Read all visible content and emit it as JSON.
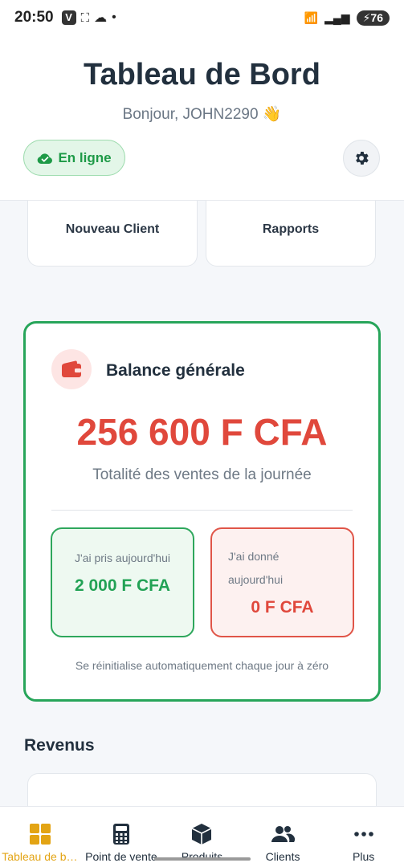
{
  "status_bar": {
    "time": "20:50",
    "battery": "76"
  },
  "header": {
    "title": "Tableau de Bord",
    "greeting": "Bonjour, JOHN2290 👋",
    "online_label": "En ligne",
    "settings_icon": "gear-icon"
  },
  "quick_actions": [
    {
      "label": "Nouveau Client"
    },
    {
      "label": "Rapports"
    }
  ],
  "balance": {
    "title": "Balance générale",
    "amount": "256 600 F CFA",
    "subtitle": "Totalité des ventes de la journée",
    "received_label": "J'ai pris aujourd'hui",
    "received_value": "2 000 F CFA",
    "given_label": "J'ai donné aujourd'hui",
    "given_value": "0 F CFA",
    "reset_note": "Se réinitialise automatiquement chaque jour à zéro"
  },
  "revenus": {
    "title": "Revenus"
  },
  "colors": {
    "accent_green": "#27a55a",
    "accent_red": "#e0483c",
    "nav_active": "#e3a414"
  },
  "bottom_nav": [
    {
      "label": "Tableau de bord",
      "icon": "grid-icon",
      "active": true
    },
    {
      "label": "Point de vente",
      "icon": "calculator-icon",
      "active": false
    },
    {
      "label": "Produits",
      "icon": "box-icon",
      "active": false
    },
    {
      "label": "Clients",
      "icon": "users-icon",
      "active": false
    },
    {
      "label": "Plus",
      "icon": "more-icon",
      "active": false
    }
  ]
}
